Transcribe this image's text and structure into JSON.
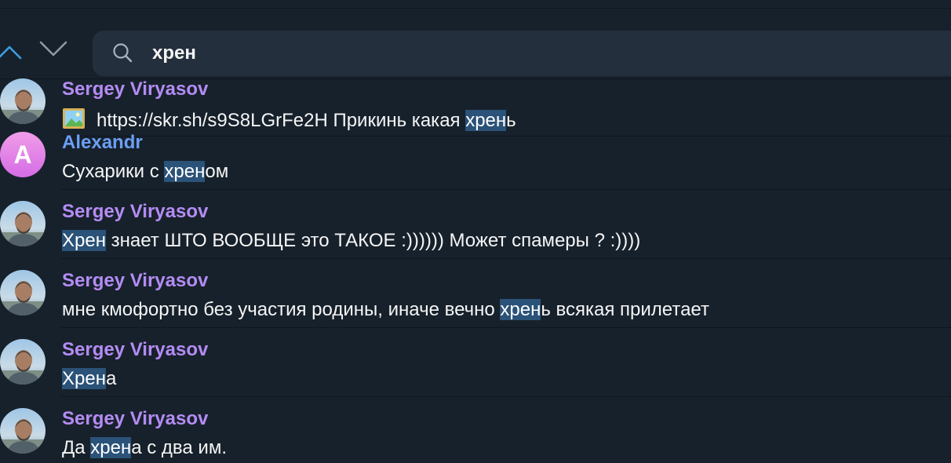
{
  "search": {
    "query": "хрен",
    "up_icon": "chevron-up-icon",
    "down_icon": "chevron-down-icon",
    "search_icon": "search-icon"
  },
  "colors": {
    "background": "#17212b",
    "field": "#242f3d",
    "highlight": "#2b5278",
    "name_violet": "#b48cf4",
    "name_blue": "#6b9ff4",
    "nav_active": "#3e9de0"
  },
  "results": [
    {
      "sender": "Sergey Viryasov",
      "avatar": "photo",
      "has_image": true,
      "parts": [
        {
          "text": "https://skr.sh/s9S8LGrFe2H Прикинь какая "
        },
        {
          "text": "хрен",
          "hl": true
        },
        {
          "text": "ь"
        }
      ]
    },
    {
      "sender": "Alexandr",
      "avatar": "letter",
      "avatar_letter": "A",
      "parts": [
        {
          "text": "Сухарики с "
        },
        {
          "text": "хрен",
          "hl": true
        },
        {
          "text": "ом"
        }
      ]
    },
    {
      "sender": "Sergey Viryasov",
      "avatar": "photo",
      "parts": [
        {
          "text": "Хрен",
          "hl": true
        },
        {
          "text": " знает ШТО ВООБЩЕ это ТАКОЕ :)))))) Может спамеры ? :))))"
        }
      ]
    },
    {
      "sender": "Sergey Viryasov",
      "avatar": "photo",
      "parts": [
        {
          "text": "мне кмофортно без участия родины, иначе вечно "
        },
        {
          "text": "хрен",
          "hl": true
        },
        {
          "text": "ь всякая прилетает"
        }
      ]
    },
    {
      "sender": "Sergey Viryasov",
      "avatar": "photo",
      "parts": [
        {
          "text": "Хрен",
          "hl": true
        },
        {
          "text": "а"
        }
      ]
    },
    {
      "sender": "Sergey Viryasov",
      "avatar": "photo",
      "parts": [
        {
          "text": "Да "
        },
        {
          "text": "хрен",
          "hl": true
        },
        {
          "text": "а с два им."
        }
      ]
    }
  ]
}
